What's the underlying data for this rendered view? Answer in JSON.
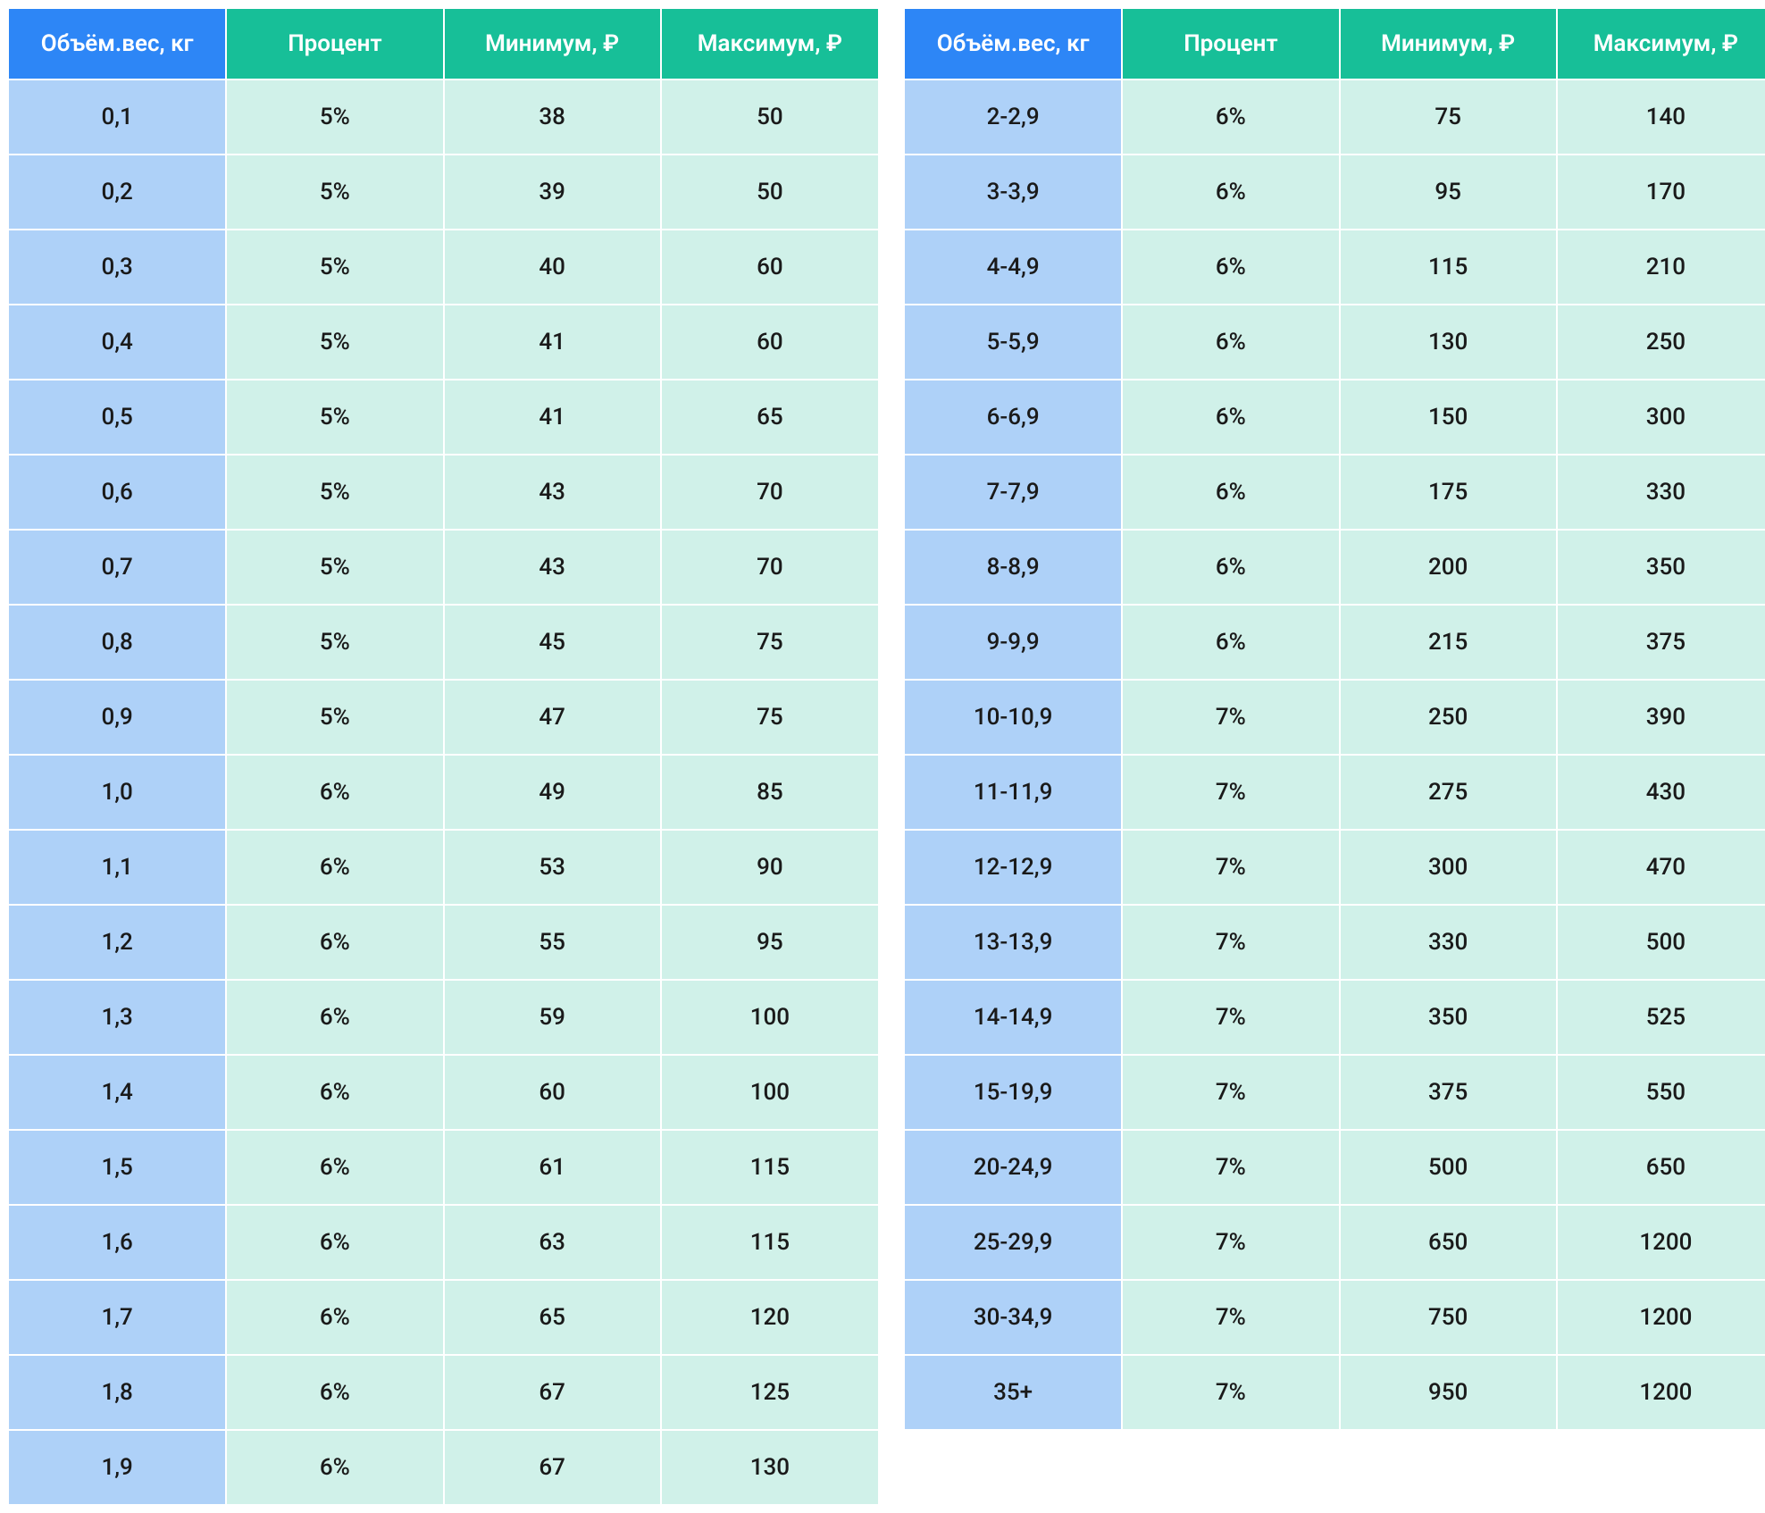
{
  "headers": {
    "weight": "Объём.вес, кг",
    "percent": "Процент",
    "min": "Минимум, ₽",
    "max": "Максимум, ₽"
  },
  "colors": {
    "header_weight_bg": "#2d86f6",
    "header_other_bg": "#17bf98",
    "cell_weight_bg": "#aed1f8",
    "cell_other_bg": "#d0f1e9"
  },
  "table_left": [
    {
      "weight": "0,1",
      "percent": "5%",
      "min": "38",
      "max": "50"
    },
    {
      "weight": "0,2",
      "percent": "5%",
      "min": "39",
      "max": "50"
    },
    {
      "weight": "0,3",
      "percent": "5%",
      "min": "40",
      "max": "60"
    },
    {
      "weight": "0,4",
      "percent": "5%",
      "min": "41",
      "max": "60"
    },
    {
      "weight": "0,5",
      "percent": "5%",
      "min": "41",
      "max": "65"
    },
    {
      "weight": "0,6",
      "percent": "5%",
      "min": "43",
      "max": "70"
    },
    {
      "weight": "0,7",
      "percent": "5%",
      "min": "43",
      "max": "70"
    },
    {
      "weight": "0,8",
      "percent": "5%",
      "min": "45",
      "max": "75"
    },
    {
      "weight": "0,9",
      "percent": "5%",
      "min": "47",
      "max": "75"
    },
    {
      "weight": "1,0",
      "percent": "6%",
      "min": "49",
      "max": "85"
    },
    {
      "weight": "1,1",
      "percent": "6%",
      "min": "53",
      "max": "90"
    },
    {
      "weight": "1,2",
      "percent": "6%",
      "min": "55",
      "max": "95"
    },
    {
      "weight": "1,3",
      "percent": "6%",
      "min": "59",
      "max": "100"
    },
    {
      "weight": "1,4",
      "percent": "6%",
      "min": "60",
      "max": "100"
    },
    {
      "weight": "1,5",
      "percent": "6%",
      "min": "61",
      "max": "115"
    },
    {
      "weight": "1,6",
      "percent": "6%",
      "min": "63",
      "max": "115"
    },
    {
      "weight": "1,7",
      "percent": "6%",
      "min": "65",
      "max": "120"
    },
    {
      "weight": "1,8",
      "percent": "6%",
      "min": "67",
      "max": "125"
    },
    {
      "weight": "1,9",
      "percent": "6%",
      "min": "67",
      "max": "130"
    }
  ],
  "table_right": [
    {
      "weight": "2-2,9",
      "percent": "6%",
      "min": "75",
      "max": "140"
    },
    {
      "weight": "3-3,9",
      "percent": "6%",
      "min": "95",
      "max": "170"
    },
    {
      "weight": "4-4,9",
      "percent": "6%",
      "min": "115",
      "max": "210"
    },
    {
      "weight": "5-5,9",
      "percent": "6%",
      "min": "130",
      "max": "250"
    },
    {
      "weight": "6-6,9",
      "percent": "6%",
      "min": "150",
      "max": "300"
    },
    {
      "weight": "7-7,9",
      "percent": "6%",
      "min": "175",
      "max": "330"
    },
    {
      "weight": "8-8,9",
      "percent": "6%",
      "min": "200",
      "max": "350"
    },
    {
      "weight": "9-9,9",
      "percent": "6%",
      "min": "215",
      "max": "375"
    },
    {
      "weight": "10-10,9",
      "percent": "7%",
      "min": "250",
      "max": "390"
    },
    {
      "weight": "11-11,9",
      "percent": "7%",
      "min": "275",
      "max": "430"
    },
    {
      "weight": "12-12,9",
      "percent": "7%",
      "min": "300",
      "max": "470"
    },
    {
      "weight": "13-13,9",
      "percent": "7%",
      "min": "330",
      "max": "500"
    },
    {
      "weight": "14-14,9",
      "percent": "7%",
      "min": "350",
      "max": "525"
    },
    {
      "weight": "15-19,9",
      "percent": "7%",
      "min": "375",
      "max": "550"
    },
    {
      "weight": "20-24,9",
      "percent": "7%",
      "min": "500",
      "max": "650"
    },
    {
      "weight": "25-29,9",
      "percent": "7%",
      "min": "650",
      "max": "1200"
    },
    {
      "weight": "30-34,9",
      "percent": "7%",
      "min": "750",
      "max": "1200"
    },
    {
      "weight": "35+",
      "percent": "7%",
      "min": "950",
      "max": "1200"
    }
  ]
}
